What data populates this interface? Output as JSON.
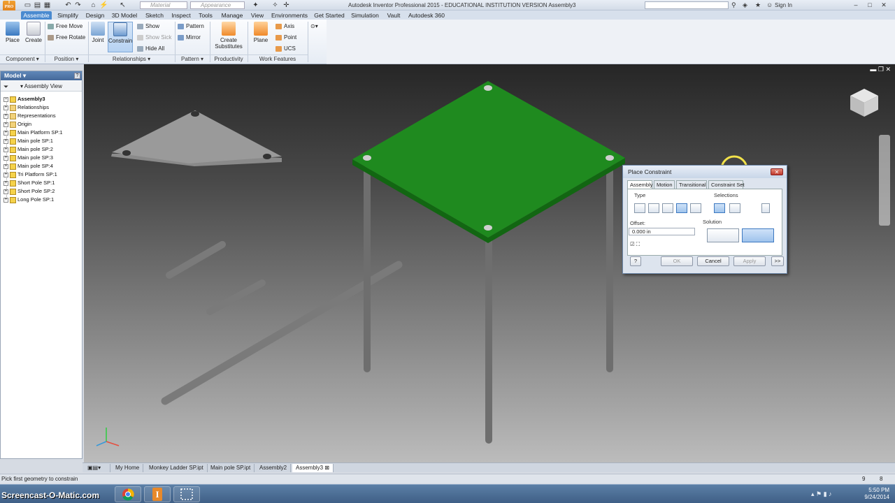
{
  "titlebar": {
    "app_icon": "I",
    "app_icon_sub": "PRO",
    "material_placeholder": "Material",
    "appearance_placeholder": "Appearance",
    "title": "Autodesk Inventor Professional 2015 - EDUCATIONAL INSTITUTION VERSION   Assembly3",
    "signin": "Sign In"
  },
  "ribbon_tabs": [
    "Assemble",
    "Simplify",
    "Design",
    "3D Model",
    "Sketch",
    "Inspect",
    "Tools",
    "Manage",
    "View",
    "Environments",
    "Get Started",
    "Simulation",
    "Vault",
    "Autodesk 360"
  ],
  "ribbon": {
    "place": "Place",
    "create": "Create",
    "free_move": "Free Move",
    "free_rotate": "Free Rotate",
    "joint": "Joint",
    "constrain": "Constrain",
    "show": "Show",
    "show_sick": "Show Sick",
    "hide_all": "Hide All",
    "pattern": "Pattern",
    "mirror": "Mirror",
    "create_substitutes": "Create Substitutes",
    "plane": "Plane",
    "axis": "Axis",
    "point": "Point",
    "ucs": "UCS",
    "groups": {
      "component": "Component ▾",
      "position": "Position ▾",
      "relationships": "Relationships ▾",
      "pattern": "Pattern ▾",
      "productivity": "Productivity",
      "work_features": "Work Features"
    }
  },
  "browser": {
    "title": "Model ▾",
    "view": "Assembly View",
    "tree": [
      {
        "label": "Assembly3",
        "root": true
      },
      {
        "label": "Relationships",
        "folder": true
      },
      {
        "label": "Representations",
        "folder": true
      },
      {
        "label": "Origin",
        "folder": true
      },
      {
        "label": "Main Platform SP:1"
      },
      {
        "label": "Main pole SP:1"
      },
      {
        "label": "Main pole SP:2"
      },
      {
        "label": "Main pole SP:3"
      },
      {
        "label": "Main pole SP:4"
      },
      {
        "label": "Tri Platform SP:1"
      },
      {
        "label": "Short Pole SP:1"
      },
      {
        "label": "Short Pole SP:2"
      },
      {
        "label": "Long Pole SP:1"
      }
    ]
  },
  "dialog": {
    "title": "Place Constraint",
    "tabs": [
      "Assembly",
      "Motion",
      "Transitional",
      "Constraint Set"
    ],
    "type_label": "Type",
    "selections_label": "Selections",
    "offset_label": "Offset:",
    "offset_value": "0.000 in",
    "solution_label": "Solution",
    "ok": "OK",
    "cancel": "Cancel",
    "apply": "Apply",
    "more": ">>"
  },
  "doc_tabs": [
    "My Home",
    "Monkey Ladder SP.ipt",
    "Main pole SP.ipt",
    "Assembly2",
    "Assembly3"
  ],
  "status": {
    "message": "Pick first geometry to constrain",
    "n1": "9",
    "n2": "8"
  },
  "taskbar": {
    "logo": "Screencast-O-Matic.com",
    "time": "5:50 PM",
    "date": "9/24/2014"
  },
  "colors": {
    "platform_green": "#1f8a1f",
    "ribbon_active": "#4a8ad0"
  }
}
